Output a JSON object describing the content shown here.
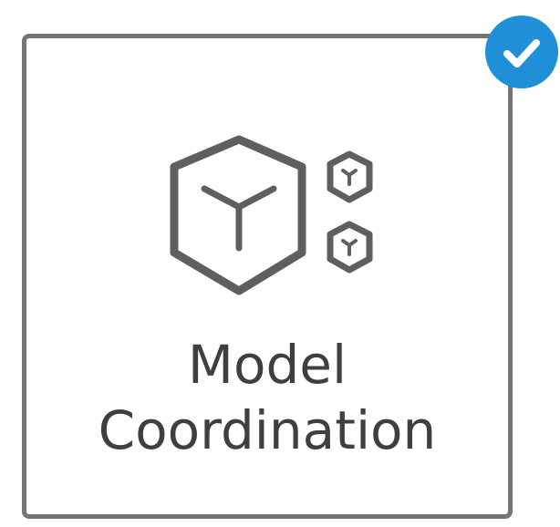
{
  "tile": {
    "label_line1": "Model",
    "label_line2": "Coordination",
    "selected": true,
    "icon": "model-coordination-icon",
    "check_icon": "checkmark-icon"
  },
  "colors": {
    "border": "#757575",
    "icon": "#5f5f5f",
    "text": "#3f3f3f",
    "badge": "#1f8fd8"
  }
}
